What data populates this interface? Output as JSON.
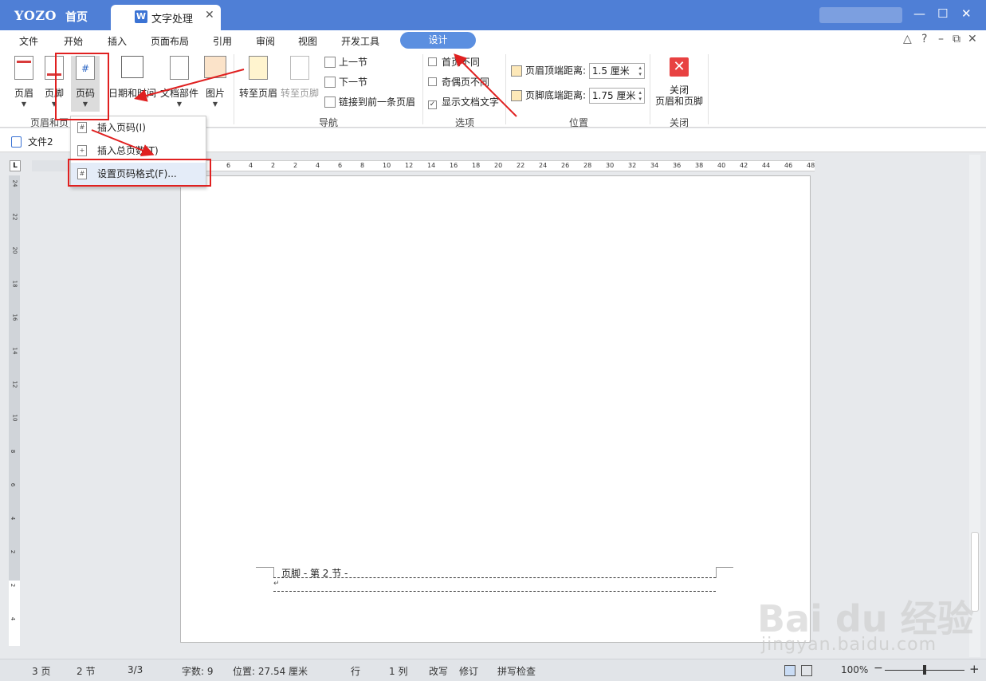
{
  "titlebar": {
    "logo": "YOZO",
    "home": "首页",
    "doc_tab": "文字处理",
    "doc_tab_icon": "W",
    "close": "✕",
    "minimize": "—",
    "maximize": "☐",
    "win_close": "✕"
  },
  "menu": {
    "items": [
      "文件",
      "开始",
      "插入",
      "页面布局",
      "引用",
      "审阅",
      "视图",
      "开发工具"
    ],
    "active": "设计",
    "right": [
      "△",
      "?",
      "–",
      "⧉",
      "✕"
    ]
  },
  "ribbon": {
    "header": "页眉",
    "footer": "页脚",
    "page_number": "页码",
    "date_time": "日期和时间",
    "doc_parts": "文档部件",
    "picture": "图片",
    "goto_header": "转至页眉",
    "goto_footer": "转至页脚",
    "prev_section": "上一节",
    "next_section": "下一节",
    "link_prev": "链接到前一条页眉",
    "first_page_diff": "首页不同",
    "odd_even_diff": "奇偶页不同",
    "show_doc_text": "显示文档文字",
    "header_top_label": "页眉顶端距离:",
    "header_top_value": "1.5 厘米",
    "footer_bottom_label": "页脚底端距离:",
    "footer_bottom_value": "1.75 厘米",
    "close_line1": "关闭",
    "close_line2": "页眉和页脚",
    "groups": {
      "header_footer": "页眉和页",
      "nav": "导航",
      "options": "选项",
      "position": "位置",
      "close": "关闭"
    }
  },
  "tabs": {
    "file": "文件2"
  },
  "dropdown": {
    "items": [
      "插入页码(I)",
      "插入总页数(T)",
      "设置页码格式(F)..."
    ]
  },
  "ruler": {
    "h_ticks": [
      "6",
      "4",
      "2",
      "2",
      "4",
      "6",
      "8",
      "10",
      "12",
      "14",
      "16",
      "18",
      "20",
      "22",
      "24",
      "26",
      "28",
      "30",
      "32",
      "34",
      "36",
      "38",
      "40",
      "42",
      "44",
      "46",
      "48"
    ],
    "v_ticks": [
      "24",
      "22",
      "20",
      "18",
      "16",
      "14",
      "12",
      "10",
      "8",
      "6",
      "4",
      "2",
      "2",
      "4"
    ],
    "corner": "L"
  },
  "page": {
    "footer_label": "页脚 - 第 2 节 -",
    "para_mark": "↵"
  },
  "status": {
    "pages": "3 页",
    "section": "2 节",
    "page_of": "3/3",
    "words": "字数: 9",
    "position": "位置: 27.54 厘米",
    "line": "行",
    "col": "1 列",
    "overwrite": "改写",
    "track": "修订",
    "spell": "拼写检查",
    "zoom": "100%",
    "zoom_minus": "−",
    "zoom_plus": "+"
  },
  "watermark": {
    "main": "Bai du 经验",
    "url": "jingyan.baidu.com"
  }
}
